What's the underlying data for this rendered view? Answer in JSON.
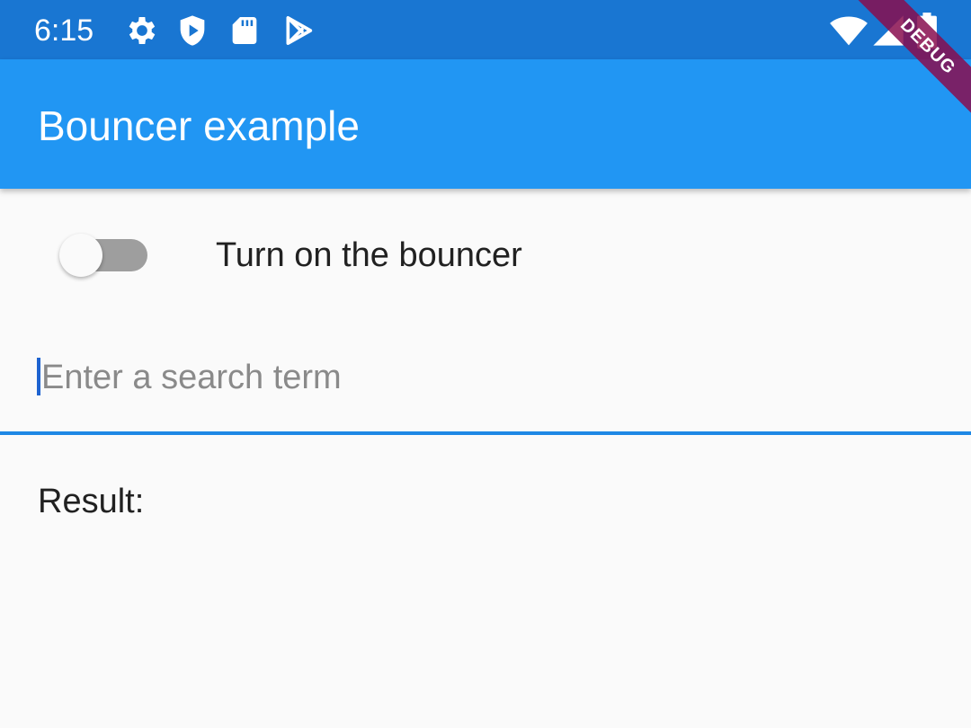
{
  "status_bar": {
    "time": "6:15",
    "left_icons": [
      "gear-icon",
      "shield-icon",
      "sd-card-icon",
      "play-store-icon"
    ],
    "right_icons": [
      "wifi-icon",
      "cell-signal-icon",
      "battery-icon"
    ],
    "background": "#1976d2"
  },
  "app_bar": {
    "title": "Bouncer example",
    "background": "#2196f3"
  },
  "debug_banner": {
    "label": "DEBUG"
  },
  "bouncer_toggle": {
    "label": "Turn on the bouncer",
    "checked": false
  },
  "search": {
    "placeholder": "Enter a search term",
    "value": "",
    "accent": "#1e88e5"
  },
  "result": {
    "label": "Result:"
  }
}
